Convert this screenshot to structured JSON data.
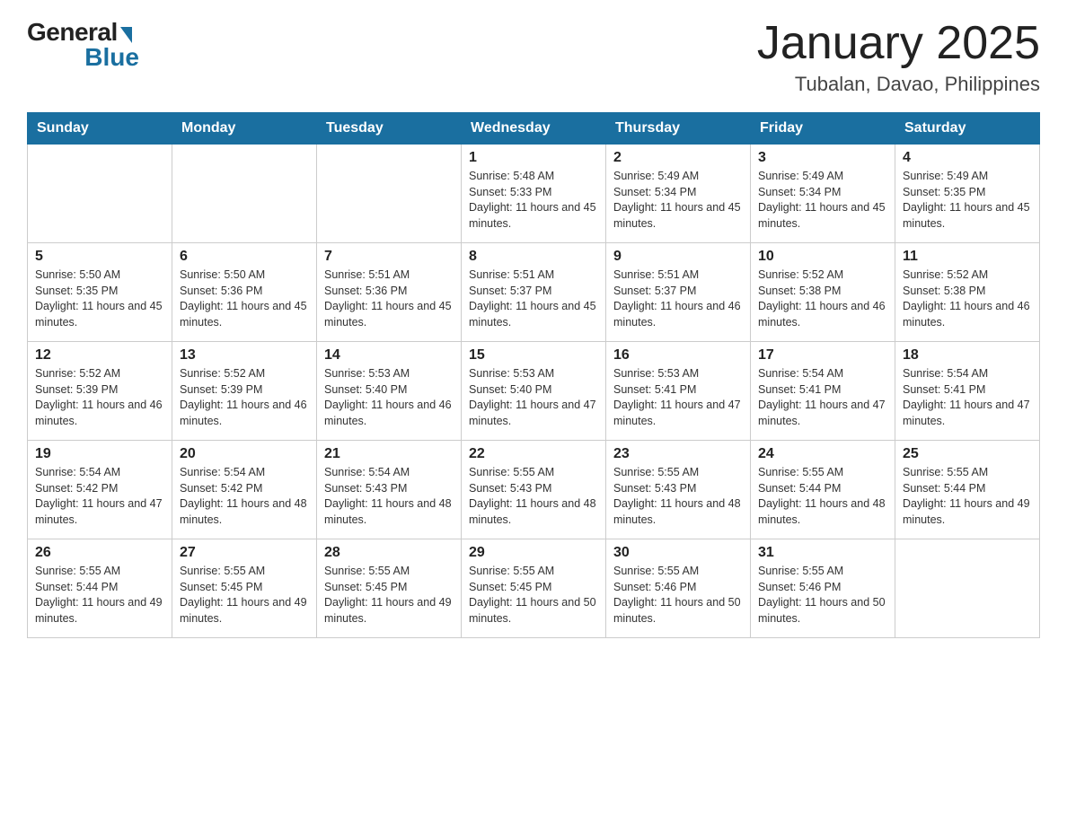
{
  "header": {
    "logo_general": "General",
    "logo_blue": "Blue",
    "month_title": "January 2025",
    "location": "Tubalan, Davao, Philippines"
  },
  "days_of_week": [
    "Sunday",
    "Monday",
    "Tuesday",
    "Wednesday",
    "Thursday",
    "Friday",
    "Saturday"
  ],
  "weeks": [
    [
      {
        "day": "",
        "info": ""
      },
      {
        "day": "",
        "info": ""
      },
      {
        "day": "",
        "info": ""
      },
      {
        "day": "1",
        "info": "Sunrise: 5:48 AM\nSunset: 5:33 PM\nDaylight: 11 hours and 45 minutes."
      },
      {
        "day": "2",
        "info": "Sunrise: 5:49 AM\nSunset: 5:34 PM\nDaylight: 11 hours and 45 minutes."
      },
      {
        "day": "3",
        "info": "Sunrise: 5:49 AM\nSunset: 5:34 PM\nDaylight: 11 hours and 45 minutes."
      },
      {
        "day": "4",
        "info": "Sunrise: 5:49 AM\nSunset: 5:35 PM\nDaylight: 11 hours and 45 minutes."
      }
    ],
    [
      {
        "day": "5",
        "info": "Sunrise: 5:50 AM\nSunset: 5:35 PM\nDaylight: 11 hours and 45 minutes."
      },
      {
        "day": "6",
        "info": "Sunrise: 5:50 AM\nSunset: 5:36 PM\nDaylight: 11 hours and 45 minutes."
      },
      {
        "day": "7",
        "info": "Sunrise: 5:51 AM\nSunset: 5:36 PM\nDaylight: 11 hours and 45 minutes."
      },
      {
        "day": "8",
        "info": "Sunrise: 5:51 AM\nSunset: 5:37 PM\nDaylight: 11 hours and 45 minutes."
      },
      {
        "day": "9",
        "info": "Sunrise: 5:51 AM\nSunset: 5:37 PM\nDaylight: 11 hours and 46 minutes."
      },
      {
        "day": "10",
        "info": "Sunrise: 5:52 AM\nSunset: 5:38 PM\nDaylight: 11 hours and 46 minutes."
      },
      {
        "day": "11",
        "info": "Sunrise: 5:52 AM\nSunset: 5:38 PM\nDaylight: 11 hours and 46 minutes."
      }
    ],
    [
      {
        "day": "12",
        "info": "Sunrise: 5:52 AM\nSunset: 5:39 PM\nDaylight: 11 hours and 46 minutes."
      },
      {
        "day": "13",
        "info": "Sunrise: 5:52 AM\nSunset: 5:39 PM\nDaylight: 11 hours and 46 minutes."
      },
      {
        "day": "14",
        "info": "Sunrise: 5:53 AM\nSunset: 5:40 PM\nDaylight: 11 hours and 46 minutes."
      },
      {
        "day": "15",
        "info": "Sunrise: 5:53 AM\nSunset: 5:40 PM\nDaylight: 11 hours and 47 minutes."
      },
      {
        "day": "16",
        "info": "Sunrise: 5:53 AM\nSunset: 5:41 PM\nDaylight: 11 hours and 47 minutes."
      },
      {
        "day": "17",
        "info": "Sunrise: 5:54 AM\nSunset: 5:41 PM\nDaylight: 11 hours and 47 minutes."
      },
      {
        "day": "18",
        "info": "Sunrise: 5:54 AM\nSunset: 5:41 PM\nDaylight: 11 hours and 47 minutes."
      }
    ],
    [
      {
        "day": "19",
        "info": "Sunrise: 5:54 AM\nSunset: 5:42 PM\nDaylight: 11 hours and 47 minutes."
      },
      {
        "day": "20",
        "info": "Sunrise: 5:54 AM\nSunset: 5:42 PM\nDaylight: 11 hours and 48 minutes."
      },
      {
        "day": "21",
        "info": "Sunrise: 5:54 AM\nSunset: 5:43 PM\nDaylight: 11 hours and 48 minutes."
      },
      {
        "day": "22",
        "info": "Sunrise: 5:55 AM\nSunset: 5:43 PM\nDaylight: 11 hours and 48 minutes."
      },
      {
        "day": "23",
        "info": "Sunrise: 5:55 AM\nSunset: 5:43 PM\nDaylight: 11 hours and 48 minutes."
      },
      {
        "day": "24",
        "info": "Sunrise: 5:55 AM\nSunset: 5:44 PM\nDaylight: 11 hours and 48 minutes."
      },
      {
        "day": "25",
        "info": "Sunrise: 5:55 AM\nSunset: 5:44 PM\nDaylight: 11 hours and 49 minutes."
      }
    ],
    [
      {
        "day": "26",
        "info": "Sunrise: 5:55 AM\nSunset: 5:44 PM\nDaylight: 11 hours and 49 minutes."
      },
      {
        "day": "27",
        "info": "Sunrise: 5:55 AM\nSunset: 5:45 PM\nDaylight: 11 hours and 49 minutes."
      },
      {
        "day": "28",
        "info": "Sunrise: 5:55 AM\nSunset: 5:45 PM\nDaylight: 11 hours and 49 minutes."
      },
      {
        "day": "29",
        "info": "Sunrise: 5:55 AM\nSunset: 5:45 PM\nDaylight: 11 hours and 50 minutes."
      },
      {
        "day": "30",
        "info": "Sunrise: 5:55 AM\nSunset: 5:46 PM\nDaylight: 11 hours and 50 minutes."
      },
      {
        "day": "31",
        "info": "Sunrise: 5:55 AM\nSunset: 5:46 PM\nDaylight: 11 hours and 50 minutes."
      },
      {
        "day": "",
        "info": ""
      }
    ]
  ]
}
